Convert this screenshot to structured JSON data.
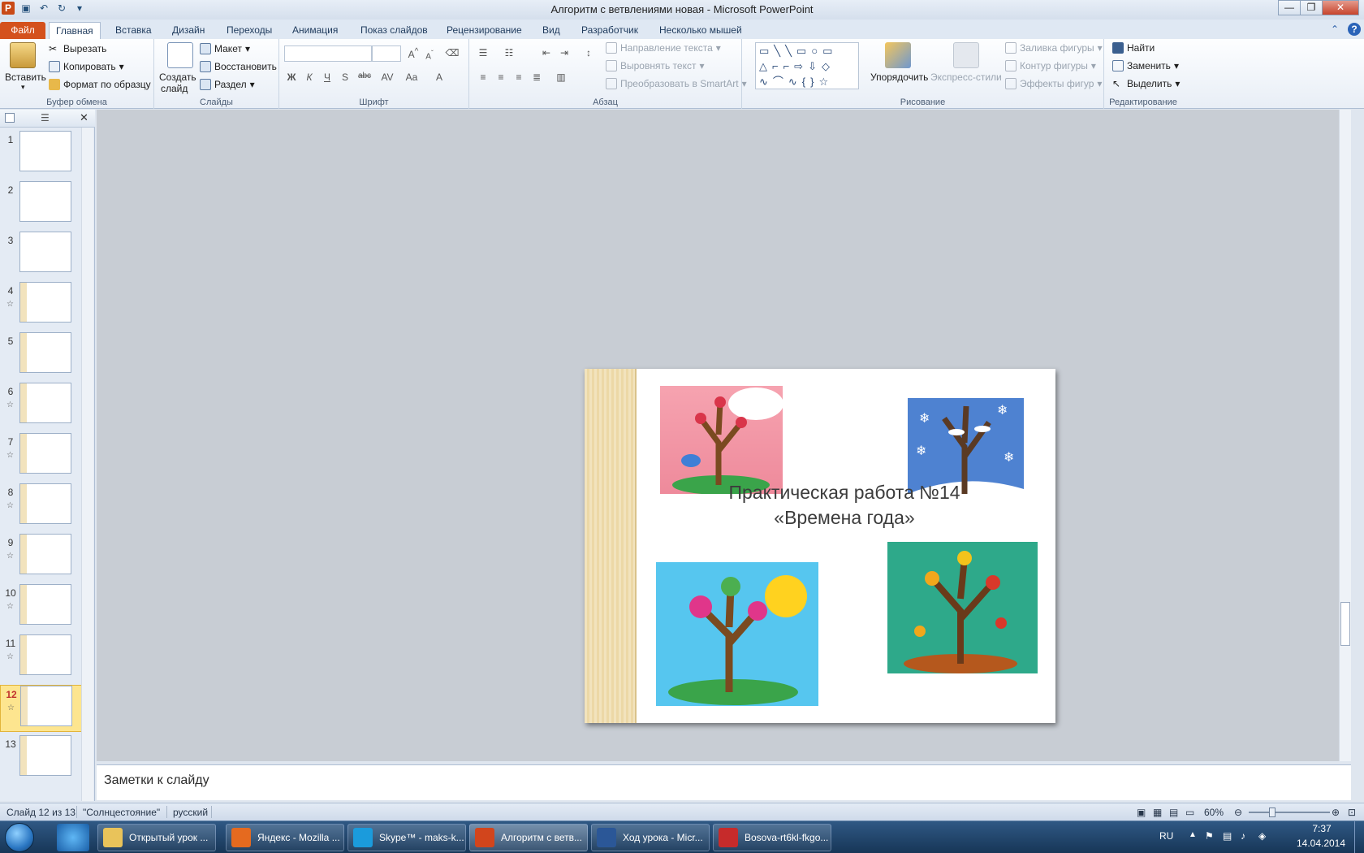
{
  "window": {
    "title": "Алгоритм с ветвлениями новая  -  Microsoft PowerPoint"
  },
  "ribbon_tabs": [
    "Файл",
    "Главная",
    "Вставка",
    "Дизайн",
    "Переходы",
    "Анимация",
    "Показ слайдов",
    "Рецензирование",
    "Вид",
    "Разработчик",
    "Несколько мышей"
  ],
  "clipboard": {
    "paste": "Вставить",
    "cut": "Вырезать",
    "copy": "Копировать",
    "format_painter": "Формат по образцу",
    "group": "Буфер обмена"
  },
  "slides_group": {
    "new_slide_1": "Создать",
    "new_slide_2": "слайд",
    "layout": "Макет",
    "reset": "Восстановить",
    "section": "Раздел",
    "group": "Слайды"
  },
  "font_group": {
    "bold": "Ж",
    "italic": "К",
    "underline": "Ч",
    "strike": "S",
    "spacing": "abc",
    "group": "Шрифт"
  },
  "paragraph_group": {
    "text_direction": "Направление текста",
    "align_text": "Выровнять текст",
    "smartart": "Преобразовать в SmartArt",
    "group": "Абзац"
  },
  "drawing_group": {
    "arrange": "Упорядочить",
    "quick_styles": "Экспресс-стили",
    "fill": "Заливка фигуры",
    "outline": "Контур фигуры",
    "effects": "Эффекты фигур",
    "group": "Рисование"
  },
  "editing_group": {
    "find": "Найти",
    "replace": "Заменить",
    "select": "Выделить",
    "group": "Редактирование"
  },
  "slides": [
    {
      "num": "1",
      "star": ""
    },
    {
      "num": "2",
      "star": ""
    },
    {
      "num": "3",
      "star": ""
    },
    {
      "num": "4",
      "star": "☆"
    },
    {
      "num": "5",
      "star": ""
    },
    {
      "num": "6",
      "star": "☆"
    },
    {
      "num": "7",
      "star": "☆"
    },
    {
      "num": "8",
      "star": "☆"
    },
    {
      "num": "9",
      "star": "☆"
    },
    {
      "num": "10",
      "star": "☆"
    },
    {
      "num": "11",
      "star": "☆"
    },
    {
      "num": "12",
      "star": "☆"
    },
    {
      "num": "13",
      "star": ""
    }
  ],
  "current_slide": {
    "title_line1": "Практическая работа №14",
    "title_line2": "«Времена года»"
  },
  "notes": {
    "placeholder": "Заметки к слайду"
  },
  "status": {
    "slide": "Слайд 12 из 13",
    "theme": "\"Солнцестояние\"",
    "language": "русский",
    "zoom": "60%"
  },
  "taskbar": {
    "items": [
      {
        "label": "Открытый урок ...",
        "color": "#e9c35a"
      },
      {
        "label": "Яндекс - Mozilla ...",
        "color": "#e56a1f"
      },
      {
        "label": "Skype™ - maks-k...",
        "color": "#1b9bdc"
      },
      {
        "label": "Алгоритм с ветв...",
        "color": "#d2451c"
      },
      {
        "label": "Ход урока - Micr...",
        "color": "#2b5797"
      },
      {
        "label": "Bosova-rt6kl-fkgo...",
        "color": "#c62b2b"
      }
    ],
    "lang": "RU",
    "time": "7:37",
    "date": "14.04.2014"
  }
}
